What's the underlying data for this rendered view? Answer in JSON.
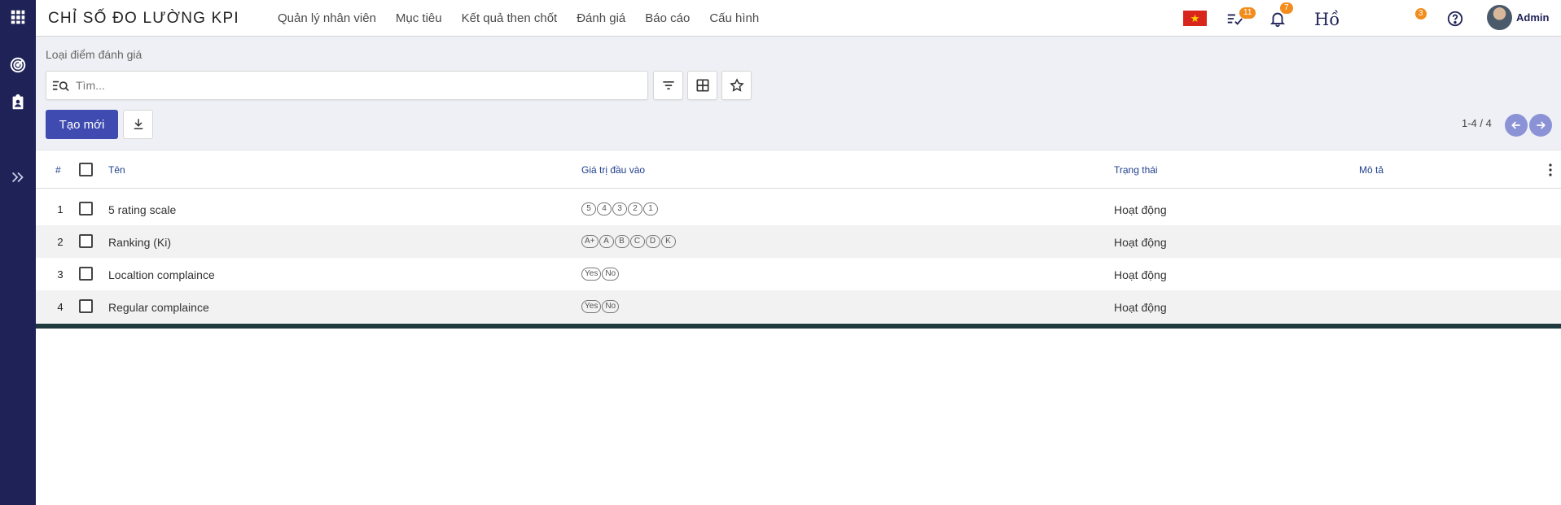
{
  "app": {
    "title": "CHỈ SỐ ĐO LƯỜNG KPI",
    "menu": [
      "Quản lý nhân viên",
      "Mục tiêu",
      "Kết quả then chốt",
      "Đánh giá",
      "Báo cáo",
      "Cấu hình"
    ],
    "flag_star": "★",
    "activity_count": "11",
    "notification_count": "7",
    "ho_text": "Hồ",
    "messages_count": "3",
    "user_name": "Admin",
    "accent_color": "#1f2256",
    "primary_button_color": "#3f4bb0",
    "badge_color": "#f28c1c"
  },
  "sidebar": {
    "icons": [
      "apps-grid-icon",
      "target-icon",
      "clipboard-user-icon",
      "expand-chevrons-icon"
    ]
  },
  "control_panel": {
    "breadcrumb": "Loại điểm đánh giá",
    "search_placeholder": "Tìm...",
    "create_label": "Tạo mới",
    "pager": "1-4 / 4"
  },
  "table": {
    "headers": {
      "num": "#",
      "name": "Tên",
      "values": "Giá trị đầu vào",
      "status": "Trạng thái",
      "description": "Mô tả"
    },
    "rows": [
      {
        "num": "1",
        "name": "5 rating scale",
        "values": [
          "5",
          "4",
          "3",
          "2",
          "1"
        ],
        "status": "Hoạt động",
        "description": ""
      },
      {
        "num": "2",
        "name": "Ranking (Ki)",
        "values": [
          "A+",
          "A",
          "B",
          "C",
          "D",
          "K"
        ],
        "status": "Hoạt động",
        "description": ""
      },
      {
        "num": "3",
        "name": "Localtion complaince",
        "values": [
          "Yes",
          "No"
        ],
        "status": "Hoạt động",
        "description": ""
      },
      {
        "num": "4",
        "name": "Regular complaince",
        "values": [
          "Yes",
          "No"
        ],
        "status": "Hoạt động",
        "description": ""
      }
    ]
  }
}
